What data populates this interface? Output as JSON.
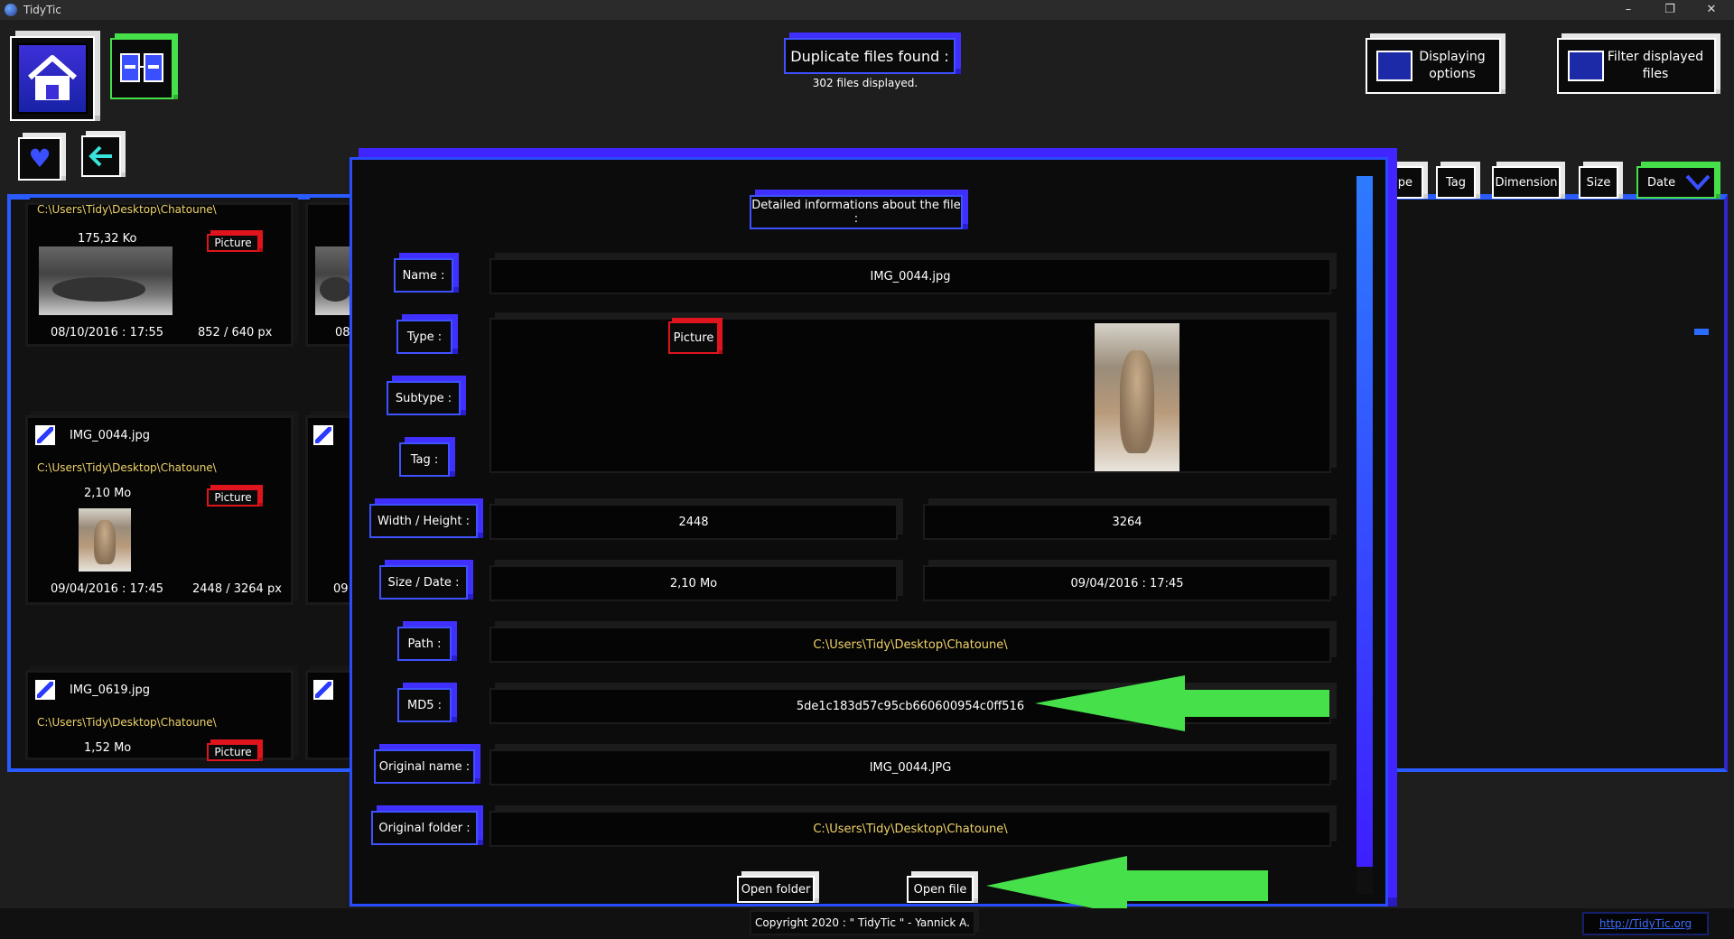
{
  "window": {
    "title": "TidyTic",
    "minimize": "–",
    "maximize": "❐",
    "close": "✕"
  },
  "header": {
    "duplicates_title": "Duplicate files found :",
    "files_count": "302 files displayed.",
    "displaying_options": "Displaying options",
    "filter_files": "Filter displayed files"
  },
  "columns": [
    "ype",
    "Tag",
    "Dimension",
    "Size",
    "Date"
  ],
  "cards": [
    {
      "path": "C:\\Users\\Tidy\\Desktop\\Chatoune\\",
      "size": "175,32 Ko",
      "type": "Picture",
      "date": "08/10/2016 : 17:55",
      "dims": "852 / 640 px"
    },
    {
      "name": "IMG_0044.jpg",
      "path": "C:\\Users\\Tidy\\Desktop\\Chatoune\\",
      "size": "2,10 Mo",
      "type": "Picture",
      "date": "09/04/2016 : 17:45",
      "dims": "2448 / 3264 px"
    },
    {
      "name": "IMG_0619.jpg",
      "path": "C:\\Users\\Tidy\\Desktop\\Chatoune\\",
      "size": "1,52 Mo",
      "type": "Picture"
    }
  ],
  "partial_cards": {
    "date_1": "08",
    "date_2": "09"
  },
  "details": {
    "heading": "Detailed informations about the file :",
    "labels": {
      "name": "Name :",
      "type": "Type :",
      "subtype": "Subtype :",
      "tag": "Tag :",
      "width_height": "Width / Height :",
      "size_date": "Size / Date :",
      "path": "Path :",
      "md5": "MD5 :",
      "original_name": "Original name :",
      "original_folder": "Original folder :"
    },
    "name": "IMG_0044.jpg",
    "type_badge": "Picture",
    "width": "2448",
    "height": "3264",
    "size": "2,10 Mo",
    "date": "09/04/2016 : 17:45",
    "path": "C:\\Users\\Tidy\\Desktop\\Chatoune\\",
    "md5": "5de1c183d57c95cb660600954c0ff516",
    "original_name": "IMG_0044.JPG",
    "original_folder": "C:\\Users\\Tidy\\Desktop\\Chatoune\\",
    "open_folder": "Open folder",
    "open_file": "Open file"
  },
  "footer": {
    "copyright": "Copyright 2020 : \" TidyTic \" - Yannick A.",
    "link": "http://TidyTic.org"
  },
  "colors": {
    "accent_blue": "#2a4cff",
    "accent_purple": "#4025ff",
    "badge_red": "#e0141c",
    "highlight_green": "#46e04a",
    "path_yellow": "#f0d36a"
  }
}
